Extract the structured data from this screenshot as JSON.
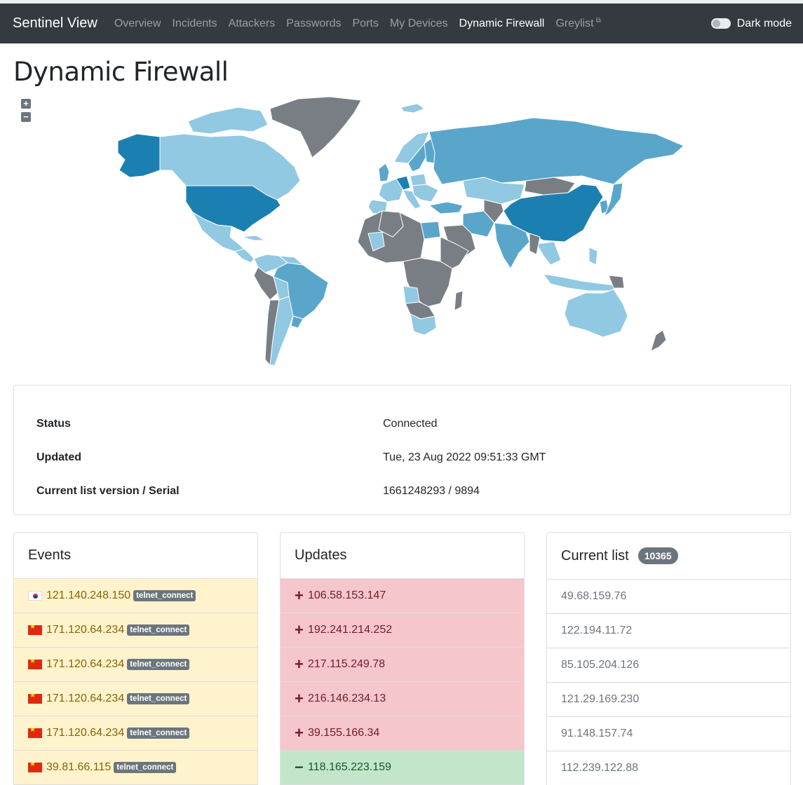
{
  "navbar": {
    "brand": "Sentinel View",
    "links": [
      {
        "label": "Overview",
        "active": false
      },
      {
        "label": "Incidents",
        "active": false
      },
      {
        "label": "Attackers",
        "active": false
      },
      {
        "label": "Passwords",
        "active": false
      },
      {
        "label": "Ports",
        "active": false
      },
      {
        "label": "My Devices",
        "active": false
      },
      {
        "label": "Dynamic Firewall",
        "active": true
      },
      {
        "label": "Greylist",
        "active": false,
        "external": true
      }
    ],
    "dark_mode_label": "Dark mode",
    "dark_mode_on": false
  },
  "page_title": "Dynamic Firewall",
  "map": {
    "zoom_in": "+",
    "zoom_out": "−",
    "colors": {
      "none": "#797e85",
      "low": "#91c8e2",
      "mid": "#5aa6cb",
      "high": "#1c7fb1"
    }
  },
  "status": {
    "rows": [
      {
        "key": "Status",
        "value": "Connected"
      },
      {
        "key": "Updated",
        "value": "Tue, 23 Aug 2022 09:51:33 GMT"
      },
      {
        "key": "Current list version / Serial",
        "value": "1661248293 / 9894"
      }
    ]
  },
  "events": {
    "title": "Events",
    "items": [
      {
        "flag": "kr-flag",
        "ip": "121.140.248.150",
        "tag": "telnet_connect"
      },
      {
        "flag": "cn-flag",
        "ip": "171.120.64.234",
        "tag": "telnet_connect"
      },
      {
        "flag": "cn-flag",
        "ip": "171.120.64.234",
        "tag": "telnet_connect"
      },
      {
        "flag": "cn-flag",
        "ip": "171.120.64.234",
        "tag": "telnet_connect"
      },
      {
        "flag": "cn-flag",
        "ip": "171.120.64.234",
        "tag": "telnet_connect"
      },
      {
        "flag": "cn-flag",
        "ip": "39.81.66.115",
        "tag": "telnet_connect"
      }
    ]
  },
  "updates": {
    "title": "Updates",
    "items": [
      {
        "op": "add",
        "sign": "+",
        "ip": "106.58.153.147"
      },
      {
        "op": "add",
        "sign": "+",
        "ip": "192.241.214.252"
      },
      {
        "op": "add",
        "sign": "+",
        "ip": "217.115.249.78"
      },
      {
        "op": "add",
        "sign": "+",
        "ip": "216.146.234.13"
      },
      {
        "op": "add",
        "sign": "+",
        "ip": "39.155.166.34"
      },
      {
        "op": "remove",
        "sign": "−",
        "ip": "118.165.223.159"
      }
    ]
  },
  "current_list": {
    "title": "Current list",
    "count": "10365",
    "items": [
      "49.68.159.76",
      "122.194.11.72",
      "85.105.204.126",
      "121.29.169.230",
      "91.148.157.74",
      "112.239.122.88"
    ]
  }
}
